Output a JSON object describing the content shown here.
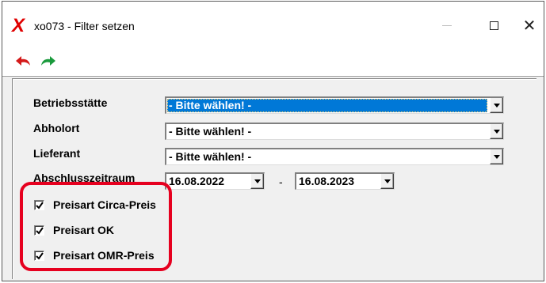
{
  "window": {
    "title": "xo073 - Filter setzen",
    "app_icon_glyph": "X",
    "close_glyph": "✕"
  },
  "toolbar": {
    "undo_icon": "undo-arrow-red",
    "redo_icon": "redo-arrow-green"
  },
  "form": {
    "betriebsstaette": {
      "label": "Betriebsstätte",
      "value": "- Bitte wählen! -"
    },
    "abholort": {
      "label": "Abholort",
      "value": "- Bitte wählen! -"
    },
    "lieferant": {
      "label": "Lieferant",
      "value": "- Bitte wählen! -"
    },
    "abschlusszeitraum": {
      "label": "Abschlusszeitraum",
      "from": "16.08.2022",
      "separator": "-",
      "to": "16.08.2023"
    }
  },
  "checkboxes": [
    {
      "label": "Preisart Circa-Preis",
      "checked": true
    },
    {
      "label": "Preisart OK",
      "checked": true
    },
    {
      "label": "Preisart OMR-Preis",
      "checked": true
    }
  ],
  "colors": {
    "selection": "#0078d7",
    "highlight": "#e6001f",
    "undo": "#d41a1a",
    "redo": "#1a9a3c"
  }
}
